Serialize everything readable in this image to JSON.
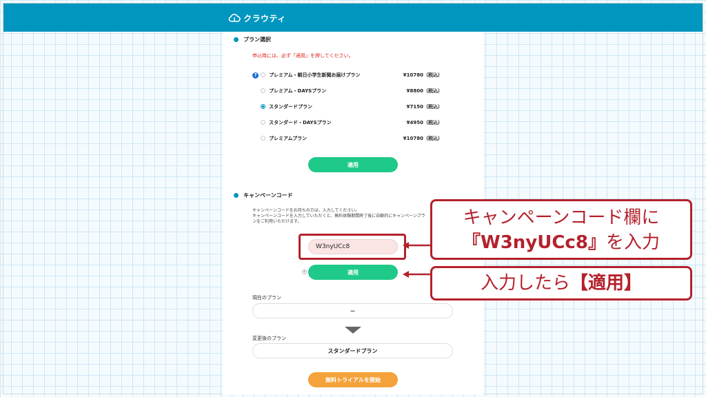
{
  "header": {
    "logo_text": "クラウティ",
    "bg_color": "#0096bf"
  },
  "plan_section": {
    "title": "プラン選択",
    "notice": "申込時には、必ず「適用」を押してください。",
    "plans": [
      {
        "name": "プレミアム・朝日小学生新聞お届けプラン",
        "price": "¥10780（税込）",
        "selected": false,
        "help": true
      },
      {
        "name": "プレミアム・DAYSプラン",
        "price": "¥8800（税込）",
        "selected": false
      },
      {
        "name": "スタンダードプラン",
        "price": "¥7150（税込）",
        "selected": true
      },
      {
        "name": "スタンダード・DAYSプラン",
        "price": "¥4950（税込）",
        "selected": false
      },
      {
        "name": "プレミアムプラン",
        "price": "¥10780（税込）",
        "selected": false
      }
    ],
    "apply_label": "適用"
  },
  "campaign_section": {
    "title": "キャンペーンコード",
    "desc_lines": [
      "キャンペーンコードをお持ちの方は、入力してください。",
      "キャンペーンコードを入力していただくと、無料体験期間終了後に自動的にキャンペーンプラ",
      "ンをご利用いただけます。"
    ],
    "code_value": "W3nyUCc8",
    "apply_label": "適用"
  },
  "current_plan": {
    "label": "現在のプラン",
    "value": "－"
  },
  "new_plan": {
    "label": "変更後のプラン",
    "value": "スタンダードプラン"
  },
  "start_trial_label": "無料トライアルを開始",
  "callouts": {
    "first_line1": "キャンペーンコード欄に",
    "first_code": "『W3nyUCc8』",
    "first_line2_suffix": "を入力",
    "second_prefix": "入力したら",
    "second_bold": "【適用】"
  },
  "colors": {
    "accent": "#0096bf",
    "green": "#1fc98a",
    "orange": "#f4a23a",
    "callout": "#b3212c"
  }
}
